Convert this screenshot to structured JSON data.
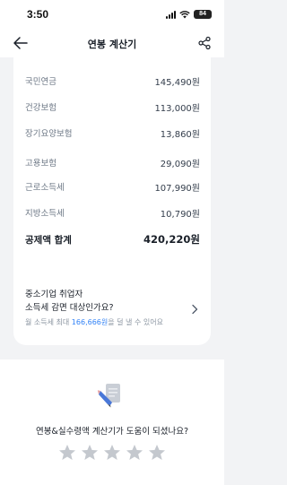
{
  "status_bar": {
    "time": "3:50",
    "battery": "84",
    "icons": [
      "signal-icon",
      "wifi-icon",
      "battery-icon"
    ]
  },
  "nav": {
    "title": "연봉 계산기",
    "back_icon": "arrow-left-icon",
    "share_icon": "share-icon"
  },
  "deductions": {
    "items": [
      {
        "label": "국민연금",
        "value": "145,490원"
      },
      {
        "label": "건강보험",
        "value": "113,000원"
      },
      {
        "label": "장기요양보험",
        "value": "13,860원"
      },
      {
        "label": "고용보험",
        "value": "29,090원"
      },
      {
        "label": "근로소득세",
        "value": "107,990원"
      },
      {
        "label": "지방소득세",
        "value": "10,790원"
      }
    ],
    "total": {
      "label": "공제액 합계",
      "value": "420,220원"
    }
  },
  "promo": {
    "line1": "중소기업 취업자",
    "line2": "소득세 감면 대상인가요?",
    "note_prefix": "월 소득세 최대 ",
    "note_highlight": "166,666원",
    "note_suffix": "을 덜 낼 수 있어요"
  },
  "feedback": {
    "question": "연봉&실수령액 계산기가 도움이 되셨나요?",
    "rating": 0,
    "max_rating": 5
  },
  "colors": {
    "background": "#f2f3f5",
    "card": "#ffffff",
    "highlight": "#3182f6",
    "star_empty": "#c4c8ce"
  }
}
